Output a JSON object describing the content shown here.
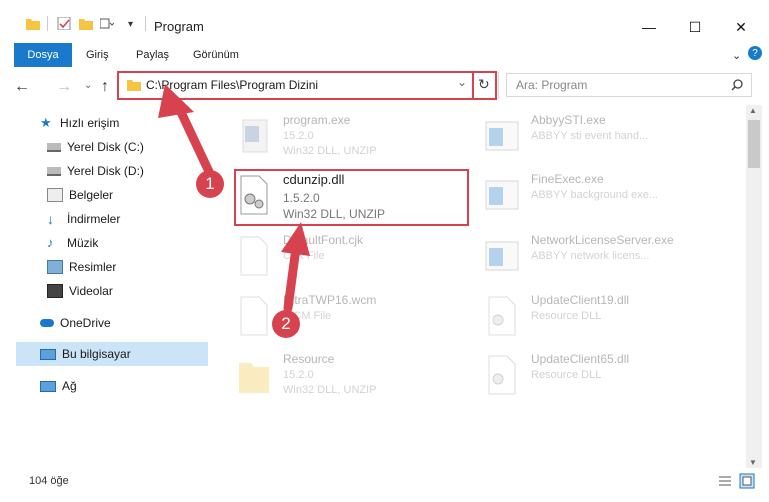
{
  "window": {
    "title": "Program",
    "minimize": "—",
    "maximize": "☐",
    "close": "✕"
  },
  "ribbon": {
    "tabs": [
      "Dosya",
      "Giriş",
      "Paylaş",
      "Görünüm"
    ],
    "help": "?"
  },
  "address": {
    "path": "C:\\Program Files\\Program Dizini",
    "dropdown": "⌄",
    "refresh": "↻"
  },
  "search": {
    "placeholder": "Ara: Program"
  },
  "nav": {
    "items": [
      {
        "label": "Hızlı erişim",
        "icon": "star-icon"
      },
      {
        "label": "Yerel Disk (C:)",
        "icon": "drive-icon"
      },
      {
        "label": "Yerel Disk (D:)",
        "icon": "drive-icon"
      },
      {
        "label": "Belgeler",
        "icon": "documents-icon"
      },
      {
        "label": "İndirmeler",
        "icon": "download-icon"
      },
      {
        "label": "Müzik",
        "icon": "music-icon"
      },
      {
        "label": "Resimler",
        "icon": "pictures-icon"
      },
      {
        "label": "Videolar",
        "icon": "video-icon"
      },
      {
        "label": "OneDrive",
        "icon": "cloud-icon"
      },
      {
        "label": "Bu bilgisayar",
        "icon": "computer-icon"
      },
      {
        "label": "Ağ",
        "icon": "network-icon"
      }
    ]
  },
  "files": [
    {
      "name": "program.exe",
      "line2": "15.2.0",
      "line3": "Win32 DLL, UNZIP"
    },
    {
      "name": "cdunzip.dll",
      "line2": "1.5.2.0",
      "line3": "Win32 DLL, UNZIP"
    },
    {
      "name": "DefaultFont.cjk",
      "line2": "CJK File",
      "line3": ""
    },
    {
      "name": "UltraTWP16.wcm",
      "line2": "WCM File",
      "line3": ""
    },
    {
      "name": "Resource",
      "line2": "15.2.0",
      "line3": "Win32 DLL, UNZIP"
    },
    {
      "name": "AbbyySTI.exe",
      "line2": "ABBYY sti event hand...",
      "line3": ""
    },
    {
      "name": "FineExec.exe",
      "line2": "ABBYY background exe...",
      "line3": ""
    },
    {
      "name": "NetworkLicenseServer.exe",
      "line2": "ABBYY network licens...",
      "line3": ""
    },
    {
      "name": "UpdateClient19.dll",
      "line2": "Resource DLL",
      "line3": ""
    },
    {
      "name": "UpdateClient65.dll",
      "line2": "Resource DLL",
      "line3": ""
    }
  ],
  "status": {
    "count": "104 öğe"
  },
  "callouts": {
    "one": "1",
    "two": "2"
  },
  "colors": {
    "accent": "#1979ca",
    "highlight": "#d6434e"
  }
}
